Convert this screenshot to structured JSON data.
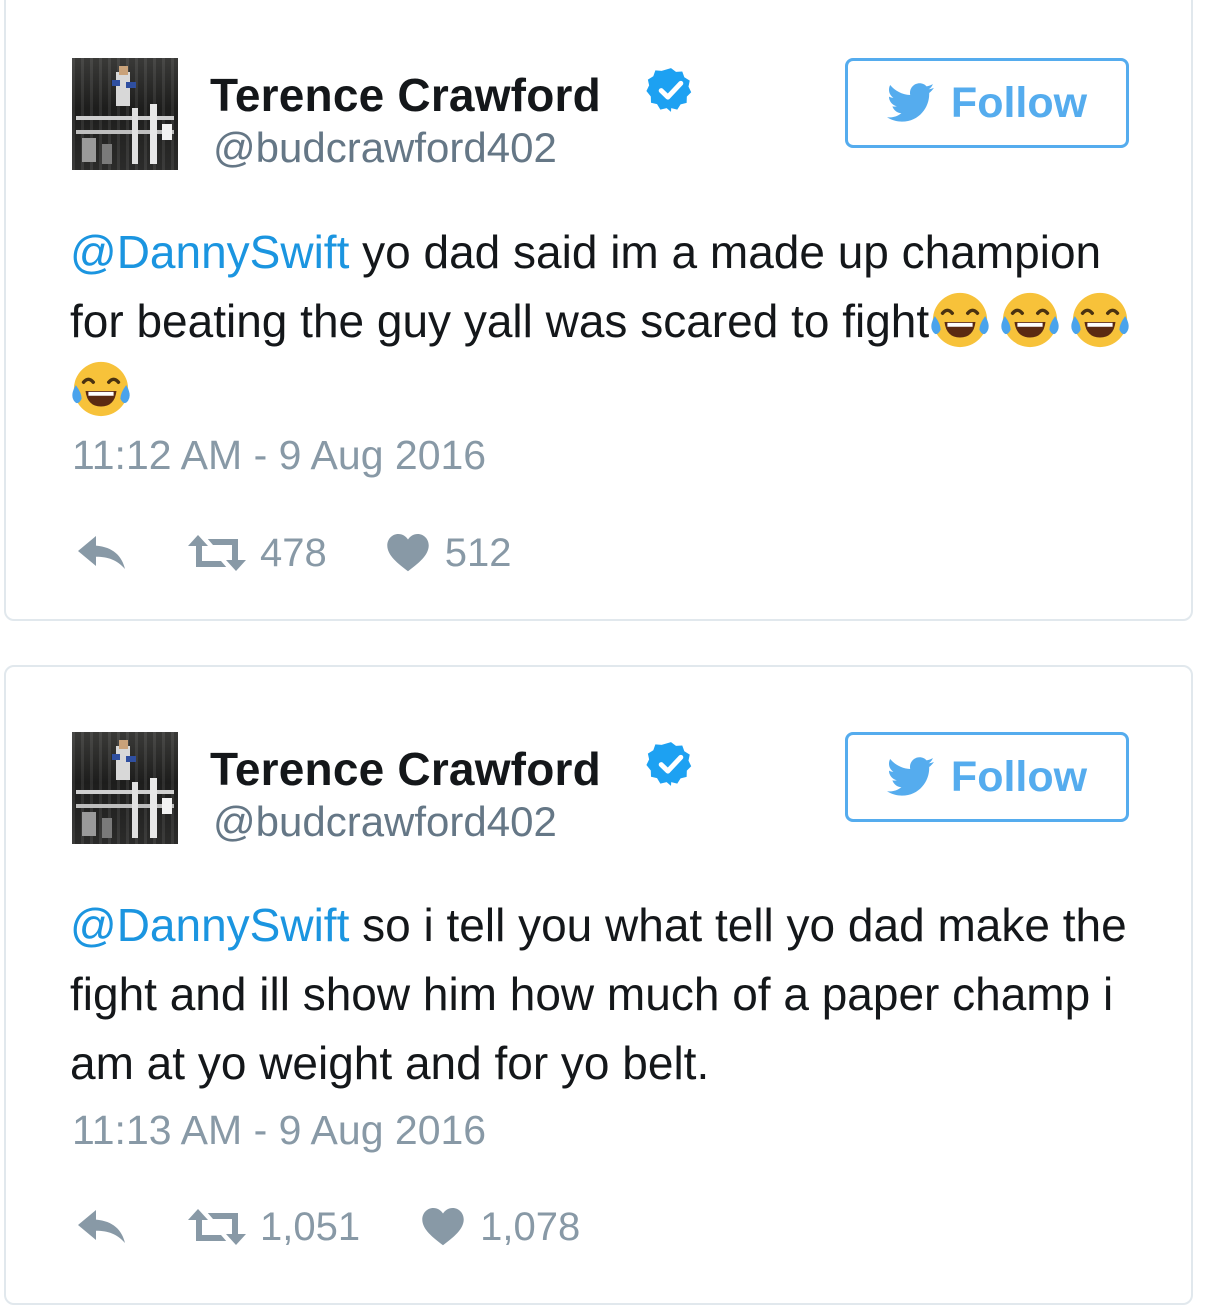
{
  "tweets": [
    {
      "author": {
        "name": "Terence Crawford",
        "handle": "@budcrawford402",
        "verified": true
      },
      "follow_label": "Follow",
      "mention": "@DannySwift",
      "text": " yo dad said im a made up champion for beating the guy yall was scared to fight",
      "emojis": [
        "face-with-tears-of-joy",
        "face-with-tears-of-joy",
        "face-with-tears-of-joy",
        "face-with-tears-of-joy"
      ],
      "timestamp": "11:12 AM - 9 Aug 2016",
      "retweets": "478",
      "likes": "512"
    },
    {
      "author": {
        "name": "Terence Crawford",
        "handle": "@budcrawford402",
        "verified": true
      },
      "follow_label": "Follow",
      "mention": "@DannySwift",
      "text": " so i tell you what tell yo dad make the fight and ill show him how much of a paper champ i am at yo weight and for yo belt.",
      "emojis": [],
      "timestamp": "11:13 AM - 9 Aug 2016",
      "retweets": "1,051",
      "likes": "1,078"
    }
  ],
  "colors": {
    "accent": "#55acee",
    "mention": "#1b95e0",
    "verified": "#1da1f2",
    "muted": "#8899a6",
    "text": "#14171a"
  },
  "icons": [
    "verified-badge-icon",
    "twitter-bird-icon",
    "reply-icon",
    "retweet-icon",
    "heart-icon",
    "tears-of-joy-emoji-icon"
  ]
}
